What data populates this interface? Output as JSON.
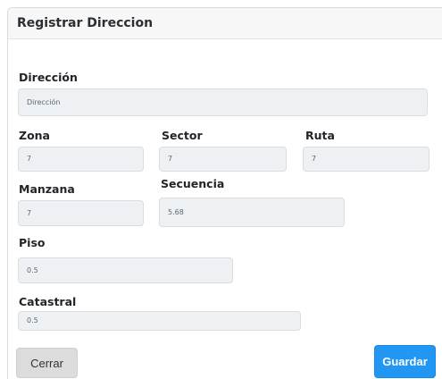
{
  "modal": {
    "title": "Registrar Direccion",
    "fields": {
      "direccion": {
        "label": "Dirección",
        "placeholder": "Dirección",
        "value": ""
      },
      "zona": {
        "label": "Zona",
        "value": "7"
      },
      "sector": {
        "label": "Sector",
        "value": "7"
      },
      "ruta": {
        "label": "Ruta",
        "value": "7"
      },
      "manzana": {
        "label": "Manzana",
        "value": "7"
      },
      "secuencia": {
        "label": "Secuencia",
        "value": "5.68"
      },
      "piso": {
        "label": "Piso",
        "value": "0.5"
      },
      "catastral": {
        "label": "Catastral",
        "value": "0.5"
      }
    },
    "buttons": {
      "close_label": "Cerrar",
      "save_label": "Guardar"
    }
  },
  "colors": {
    "accent": "#2196f3",
    "field_bg": "#eef1f4",
    "close_button_bg": "#dcdcdc"
  }
}
